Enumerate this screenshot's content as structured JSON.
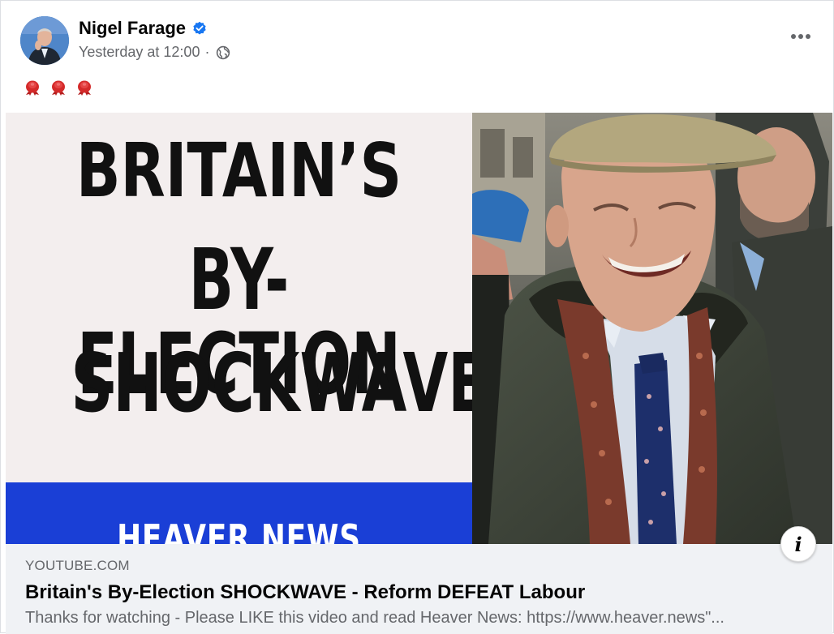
{
  "post": {
    "author": "Nigel Farage",
    "verified": true,
    "timestamp": "Yesterday at 12:00",
    "separator": "·",
    "audience_icon": "globe-icon",
    "more_icon": "more-options-icon",
    "emojis": [
      "rosette-icon",
      "rosette-icon",
      "rosette-icon"
    ],
    "colors": {
      "verified_badge": "#1877f2",
      "rosette": "#d42a2a",
      "band": "#1a3fd6",
      "card_bg": "#f0f2f5"
    }
  },
  "thumbnail": {
    "headline_line1": "BRITAIN’S",
    "headline_line2": "BY-ELECTION",
    "headline_line3": "SHOCKWAVE",
    "band_text": "HEAVER NEWS",
    "info_label": "i"
  },
  "link": {
    "domain": "YOUTUBE.COM",
    "title": "Britain's By-Election SHOCKWAVE - Reform DEFEAT Labour",
    "description": "Thanks for watching - Please LIKE this video and read Heaver News: https://www.heaver.news\"..."
  }
}
